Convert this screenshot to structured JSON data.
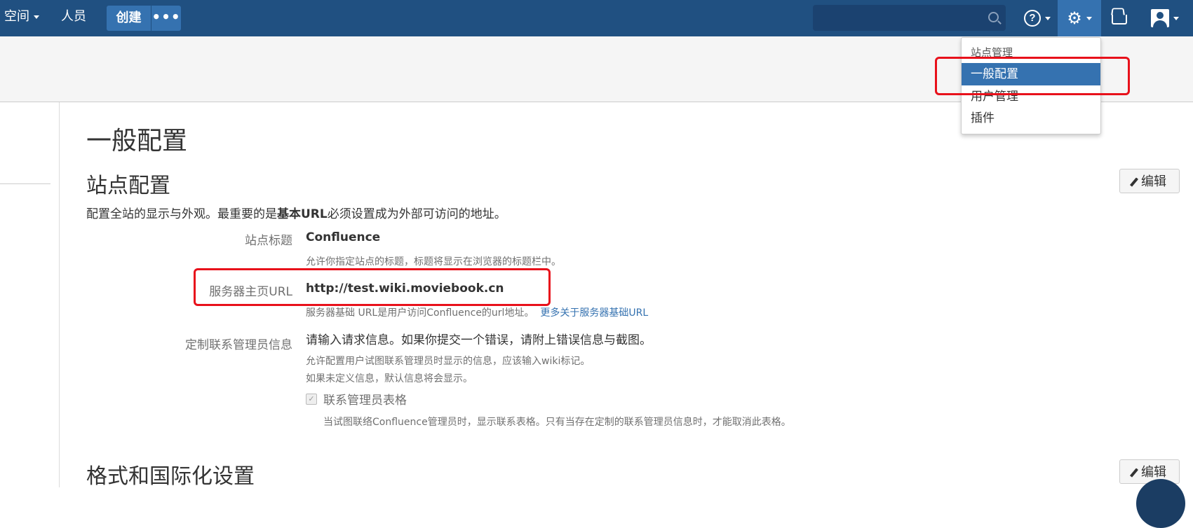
{
  "topbar": {
    "spaces": "空间",
    "people": "人员",
    "create": "创建",
    "more": "•••",
    "search_placeholder": "",
    "help_icon": "?",
    "gear_icon": "⚙"
  },
  "admin_menu": {
    "heading": "站点管理",
    "items": [
      "一般配置",
      "用户管理",
      "插件"
    ]
  },
  "page": {
    "title": "一般配置",
    "section1": {
      "title": "站点配置",
      "edit": "编辑",
      "intro_pre": "配置全站的显示与外观。最重要的是",
      "intro_bold": "基本URL",
      "intro_post": "必须设置成为外部可访问的地址。",
      "fields": [
        {
          "label": "站点标题",
          "value": "Confluence",
          "desc": "允许你指定站点的标题，标题将显示在浏览器的标题栏中。"
        },
        {
          "label": "服务器主页URL",
          "value": "http://test.wiki.moviebook.cn",
          "desc": "服务器基础 URL是用户访问Confluence的url地址。",
          "link": "更多关于服务器基础URL"
        },
        {
          "label": "定制联系管理员信息",
          "value": "请输入请求信息。如果你提交一个错误，请附上错误信息与截图。",
          "desc": "允许配置用户试图联系管理员时显示的信息，应该输入wiki标记。",
          "desc2": "如果未定义信息，默认信息将会显示。"
        }
      ],
      "checkbox_label": "联系管理员表格",
      "checkbox_desc": "当试图联络Confluence管理员时，显示联系表格。只有当存在定制的联系管理员信息时，才能取消此表格。"
    },
    "section2": {
      "title": "格式和国际化设置",
      "edit": "编辑"
    }
  }
}
